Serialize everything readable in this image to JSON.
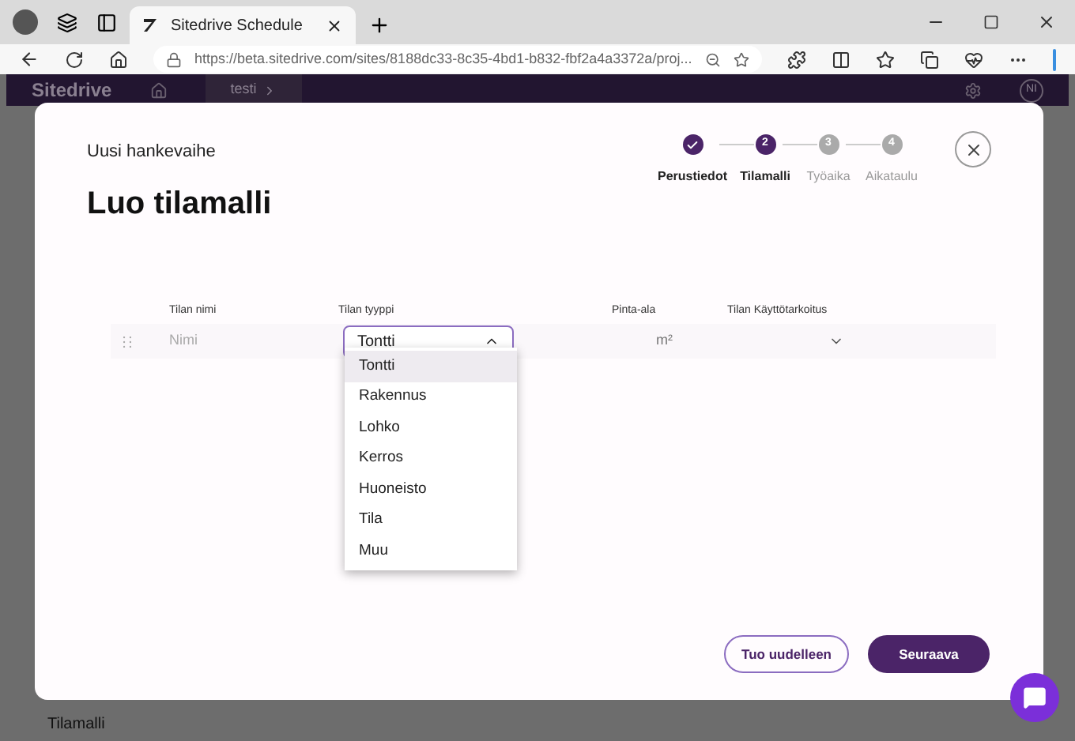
{
  "browser": {
    "tab_title": "Sitedrive Schedule",
    "url": "https://beta.sitedrive.com/sites/8188dc33-8c35-4bd1-b832-fbf2a4a3372a/proj..."
  },
  "app_header": {
    "logo": "Sitedrive",
    "breadcrumb": "testi",
    "avatar": "NI"
  },
  "background": {
    "label": "Tilamalli"
  },
  "modal": {
    "subtitle": "Uusi hankevaihe",
    "title": "Luo tilamalli",
    "steps": [
      {
        "label": "Perustiedot",
        "kind": "done"
      },
      {
        "number": "2",
        "label": "Tilamalli",
        "kind": "current"
      },
      {
        "number": "3",
        "label": "Työaika",
        "kind": "pending"
      },
      {
        "number": "4",
        "label": "Aikataulu",
        "kind": "pending"
      }
    ],
    "columns": [
      "Tilan nimi",
      "Tilan tyyppi",
      "Pinta-ala",
      "Tilan Käyttötarkoitus"
    ],
    "row": {
      "name_placeholder": "Nimi",
      "type_value": "Tontti",
      "unit": "m²"
    },
    "type_options": [
      {
        "label": "Tontti",
        "selected": true
      },
      {
        "label": "Rakennus",
        "selected": false
      },
      {
        "label": "Lohko",
        "selected": false
      },
      {
        "label": "Kerros",
        "selected": false
      },
      {
        "label": "Huoneisto",
        "selected": false
      },
      {
        "label": "Tila",
        "selected": false
      },
      {
        "label": "Muu",
        "selected": false
      }
    ],
    "buttons": {
      "secondary": "Tuo uudelleen",
      "primary": "Seuraava"
    }
  }
}
